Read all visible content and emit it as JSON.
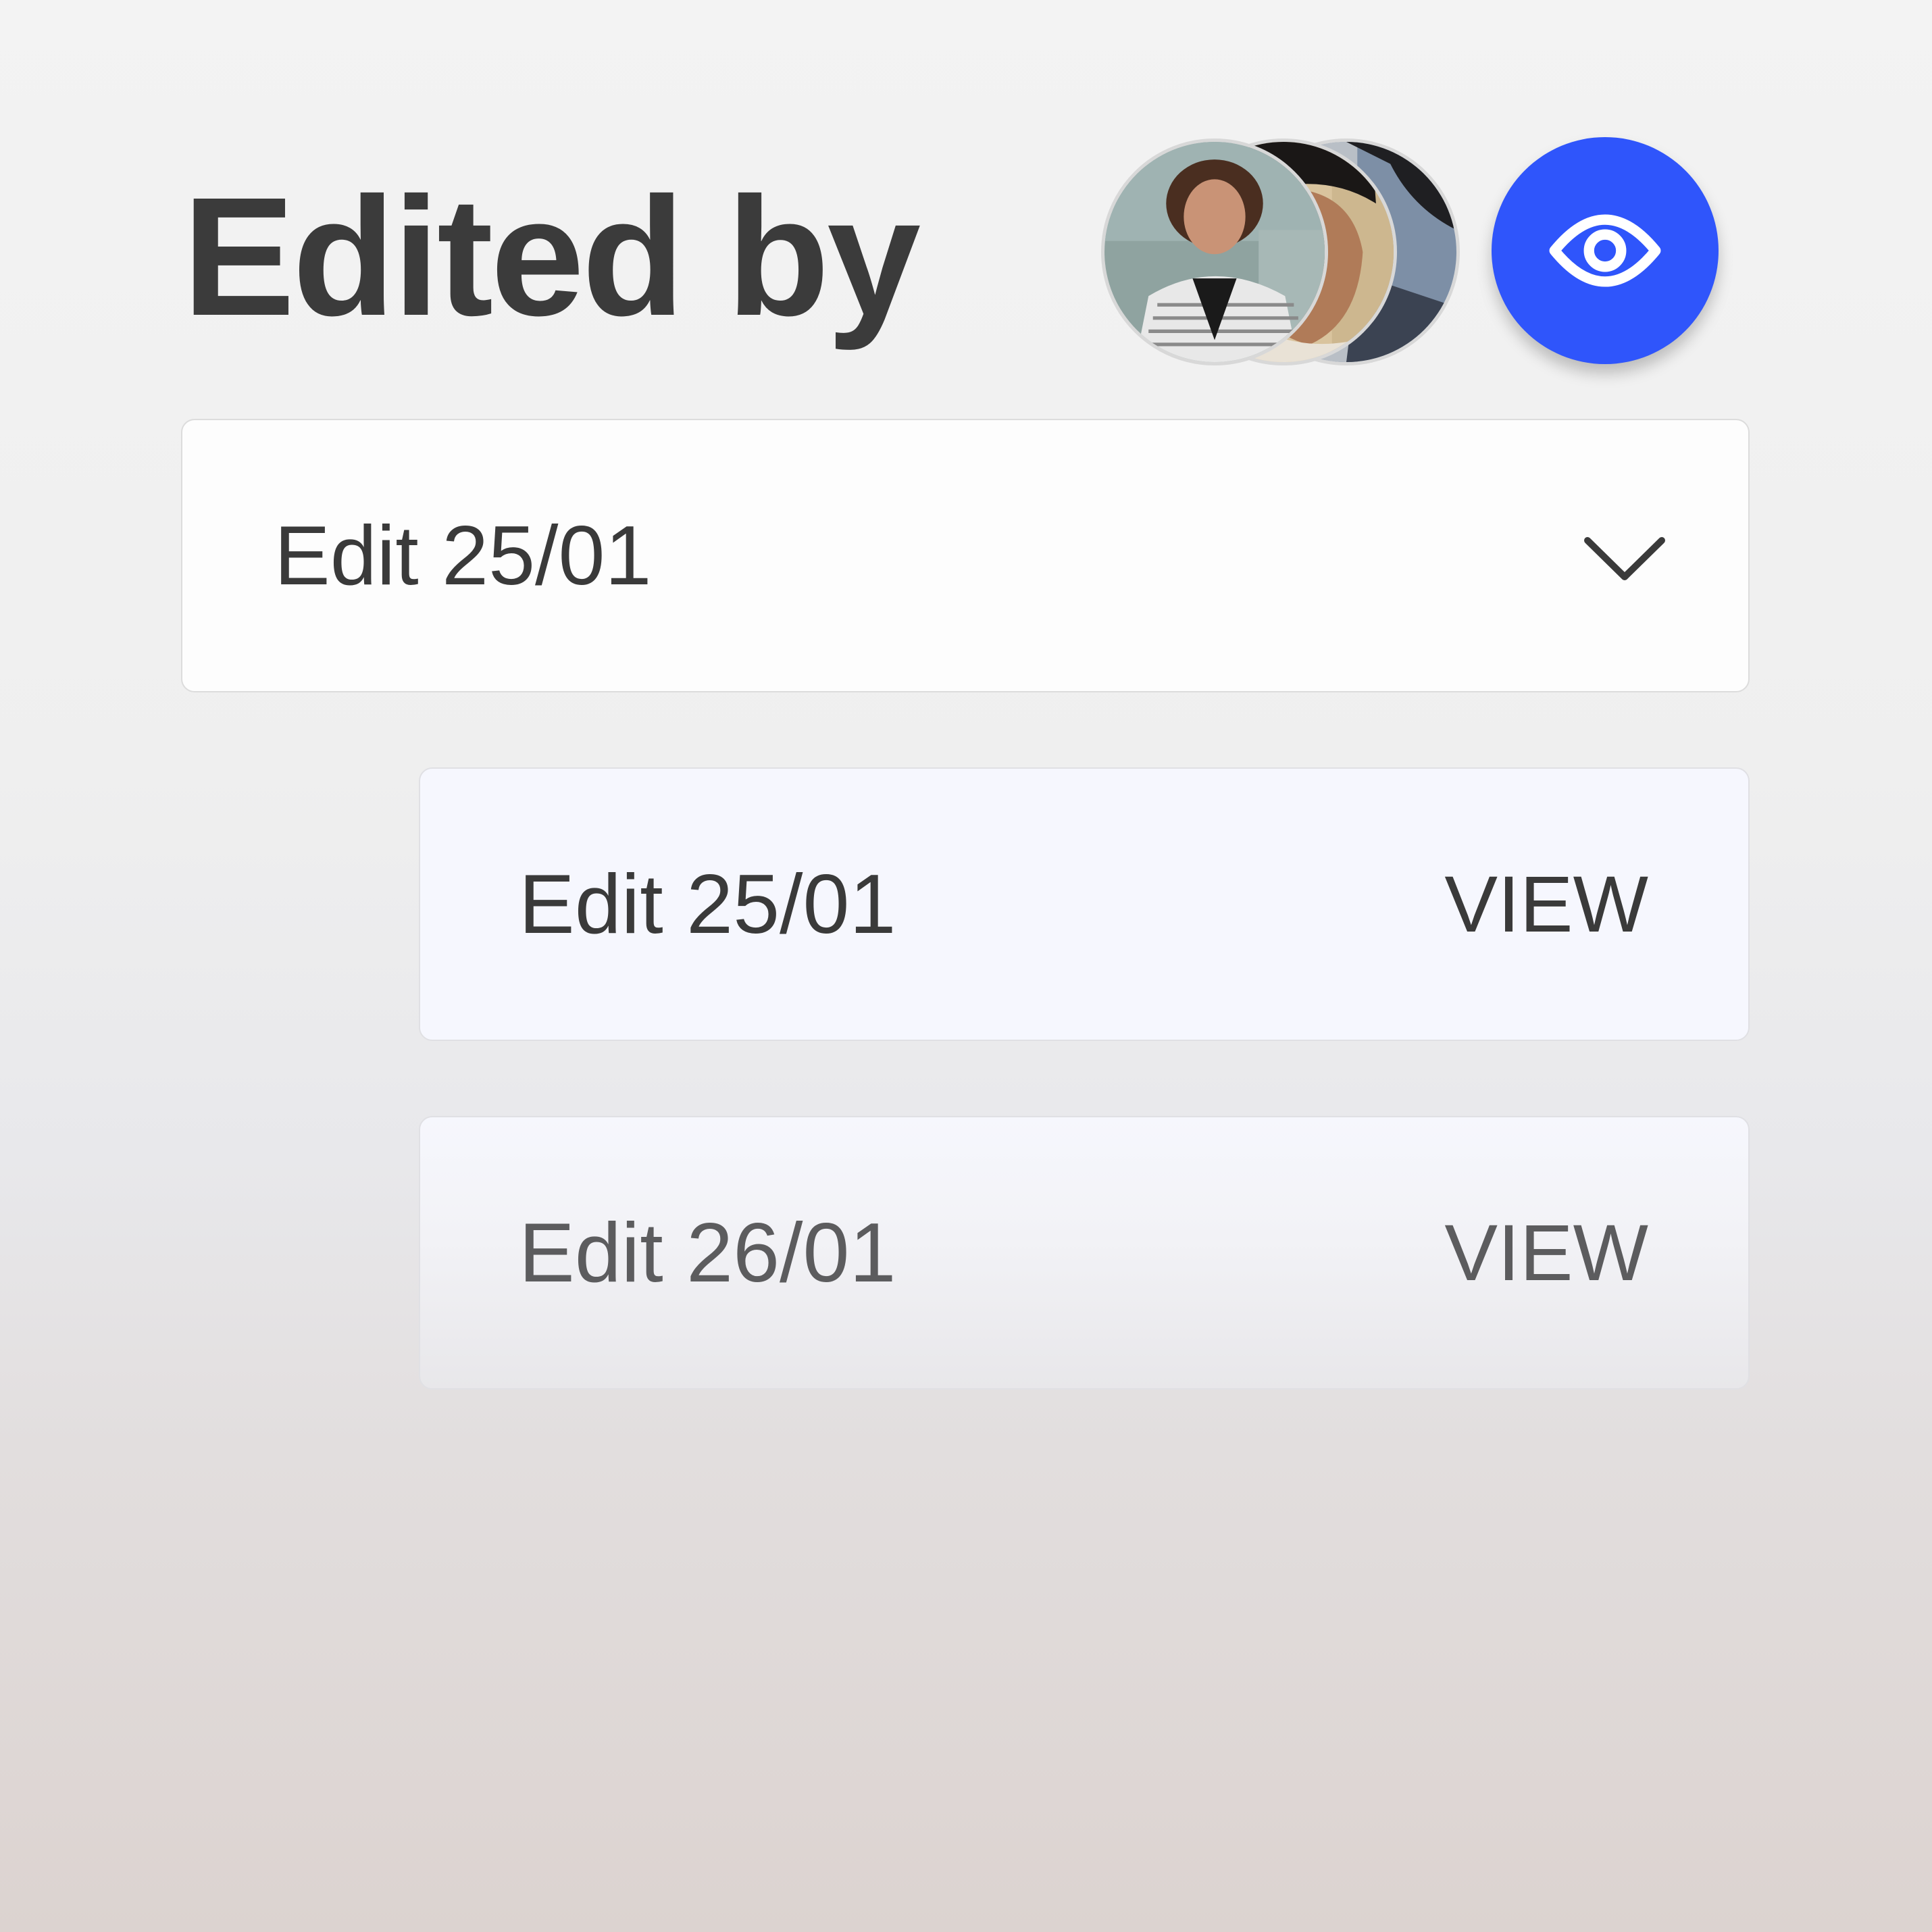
{
  "header": {
    "title": "Edited by"
  },
  "editors": {
    "avatars": [
      {
        "name": "avatar-woman-curly-hair"
      },
      {
        "name": "avatar-man-dark-hair"
      },
      {
        "name": "avatar-man-suit"
      }
    ],
    "view_icon": "eye-icon",
    "accent_color": "#2f55fb"
  },
  "dropdown": {
    "selected_label": "Edit 25/01",
    "icon": "chevron-down-icon"
  },
  "edits": [
    {
      "label": "Edit 25/01",
      "action": "VIEW"
    },
    {
      "label": "Edit 26/01",
      "action": "VIEW"
    }
  ]
}
